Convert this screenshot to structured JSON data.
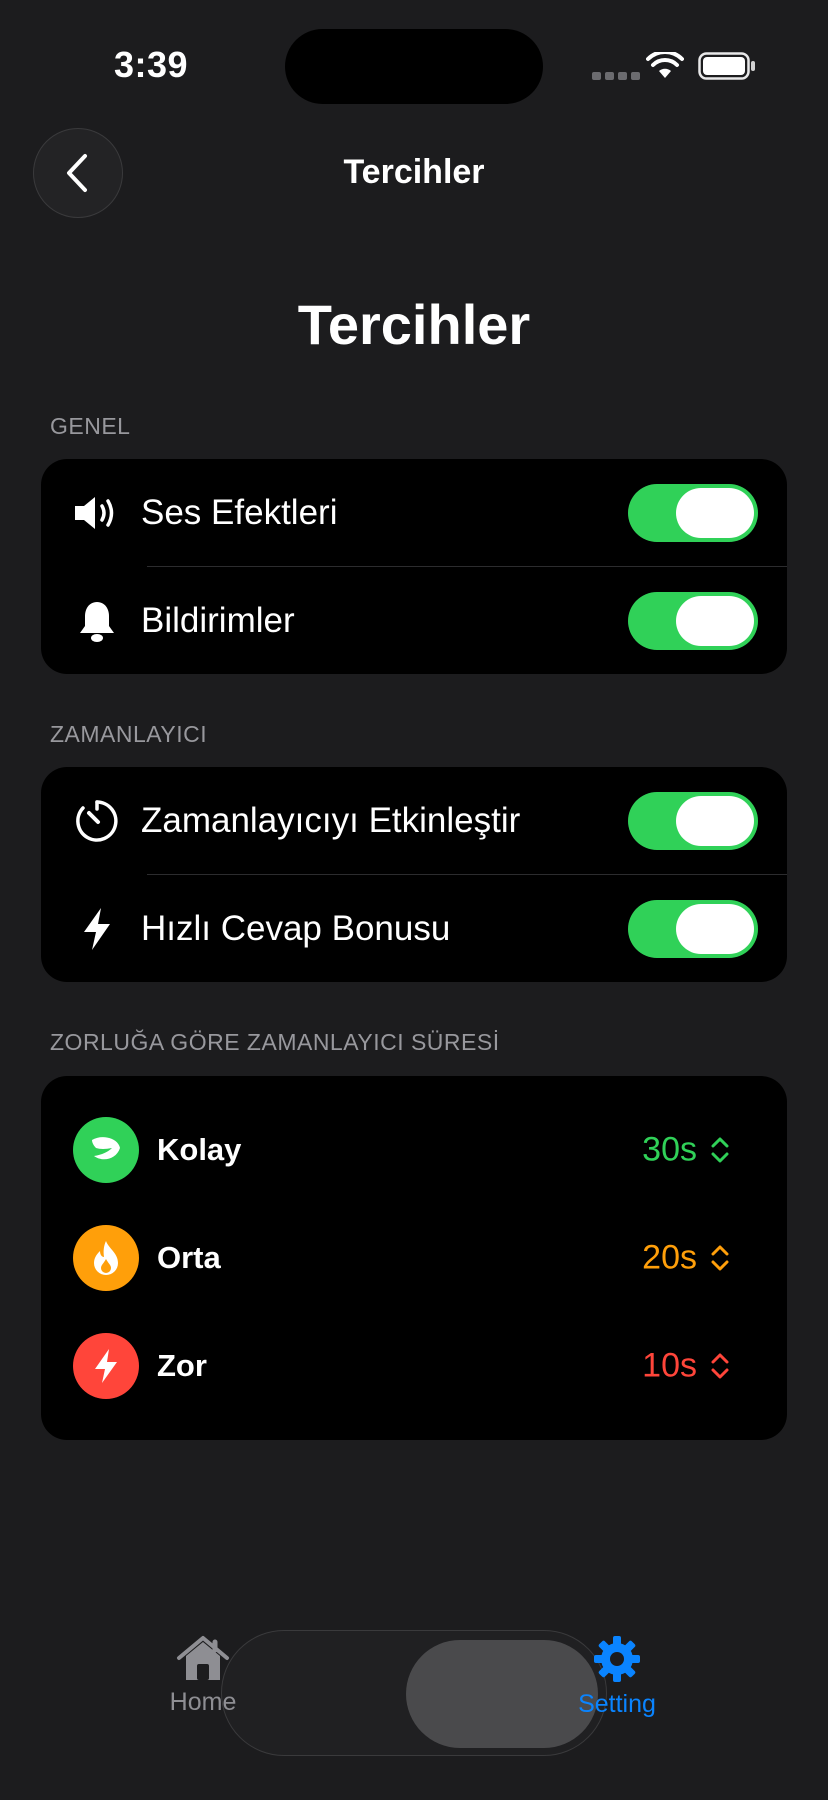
{
  "status_bar": {
    "time": "3:39"
  },
  "nav": {
    "title": "Tercihler",
    "back_icon": "chevron-left-icon"
  },
  "page": {
    "large_title": "Tercihler"
  },
  "sections": {
    "general": {
      "header": "GENEL",
      "rows": [
        {
          "label": "Ses Efektleri",
          "icon": "speaker-icon",
          "on": true
        },
        {
          "label": "Bildirimler",
          "icon": "bell-icon",
          "on": true
        }
      ]
    },
    "timer": {
      "header": "ZAMANLAYICI",
      "rows": [
        {
          "label": "Zamanlayıcıyı Etkinleştir",
          "icon": "timer-icon",
          "on": true
        },
        {
          "label": "Hızlı Cevap Bonusu",
          "icon": "bolt-icon",
          "on": true
        }
      ]
    },
    "difficulty": {
      "header": "ZORLUĞA GÖRE ZAMANLAYICI SÜRESİ",
      "rows": [
        {
          "label": "Kolay",
          "value": "30s",
          "color": "#30d158",
          "icon": "leaf-icon"
        },
        {
          "label": "Orta",
          "value": "20s",
          "color": "#ff9f0a",
          "icon": "flame-icon"
        },
        {
          "label": "Zor",
          "value": "10s",
          "color": "#ff453a",
          "icon": "bolt-icon"
        }
      ]
    }
  },
  "tab_bar": {
    "tabs": [
      {
        "label": "Home",
        "icon": "house-icon",
        "active": false,
        "color": "#8e8e93"
      },
      {
        "label": "Setting",
        "icon": "gear-icon",
        "active": true,
        "color": "#0a84ff"
      }
    ]
  },
  "colors": {
    "toggle_on": "#30d158",
    "background": "#1c1c1e",
    "card": "#000000",
    "accent": "#0a84ff"
  }
}
